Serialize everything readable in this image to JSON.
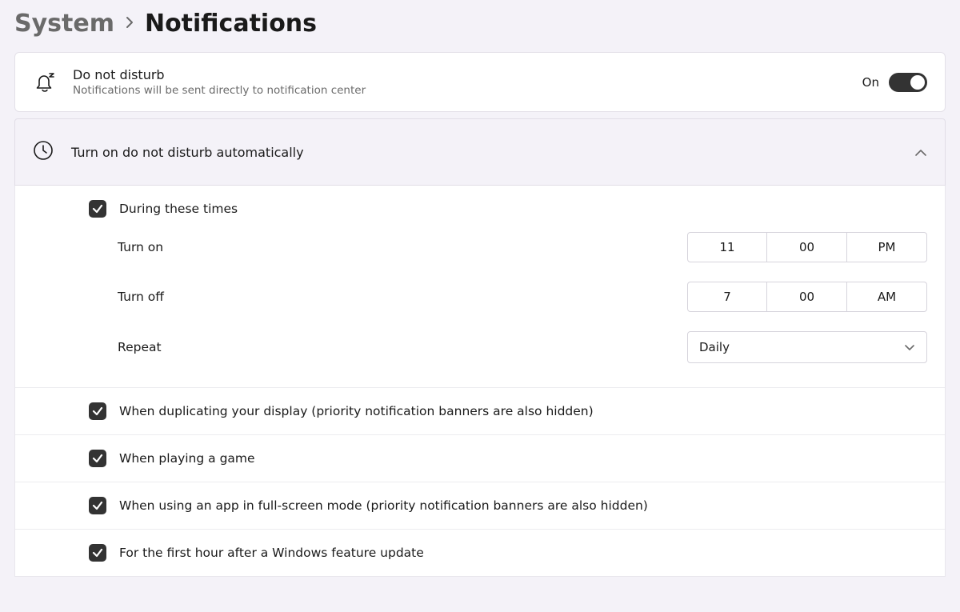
{
  "breadcrumb": {
    "parent": "System",
    "current": "Notifications"
  },
  "dnd": {
    "title": "Do not disturb",
    "subtitle": "Notifications will be sent directly to notification center",
    "state_label": "On",
    "on": true
  },
  "auto": {
    "title": "Turn on do not disturb automatically",
    "expanded": true,
    "during_times": {
      "checked": true,
      "label": "During these times",
      "turn_on_label": "Turn on",
      "turn_on": {
        "hour": "11",
        "minute": "00",
        "ampm": "PM"
      },
      "turn_off_label": "Turn off",
      "turn_off": {
        "hour": "7",
        "minute": "00",
        "ampm": "AM"
      },
      "repeat_label": "Repeat",
      "repeat_value": "Daily"
    },
    "rules": [
      {
        "checked": true,
        "label": "When duplicating your display (priority notification banners are also hidden)"
      },
      {
        "checked": true,
        "label": "When playing a game"
      },
      {
        "checked": true,
        "label": "When using an app in full-screen mode (priority notification banners are also hidden)"
      },
      {
        "checked": true,
        "label": "For the first hour after a Windows feature update"
      }
    ]
  }
}
